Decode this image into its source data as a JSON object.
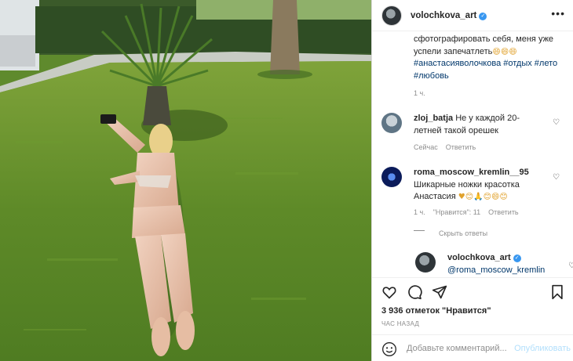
{
  "post": {
    "author": "volochkova_art",
    "verified_mark": "✓",
    "more_icon": "more-dots-icon",
    "caption_lines": [
      "сфотографировать себя, меня уже",
      "успели запечатлеть"
    ],
    "caption_emoji": "😄😄😄",
    "hashtags_line1": "#анастасияволочкова #отдых #лето",
    "hashtags_line2": "#любовь",
    "caption_time": "1 ч."
  },
  "comments": [
    {
      "user": "zloj_batja",
      "text": "Не у каждой 20-летней такой орешек",
      "time": "Сейчас",
      "reply": "Ответить"
    },
    {
      "user": "roma_moscow_kremlin__95",
      "text": "Шикарные ножки красотка Анастасия",
      "emoji": "♥😊🙏😊😄😊",
      "time": "1 ч.",
      "likes": "\"Нравится\": 11",
      "reply": "Ответить"
    }
  ],
  "hide_replies": "Скрыть ответы",
  "reply_comment": {
    "user": "volochkova_art",
    "mention": "@roma_moscow_kremlin"
  },
  "actions": {
    "likes_text": "3 936 отметок \"Нравится\"",
    "time_ago": "ЧАС НАЗАД"
  },
  "add_comment": {
    "placeholder": "Добавьте комментарий...",
    "publish_label": "Опубликовать"
  },
  "colors": {
    "link": "#00376b",
    "verified": "#3897f0",
    "muted": "#8e8e8e",
    "publish_disabled": "#b2dffc"
  }
}
